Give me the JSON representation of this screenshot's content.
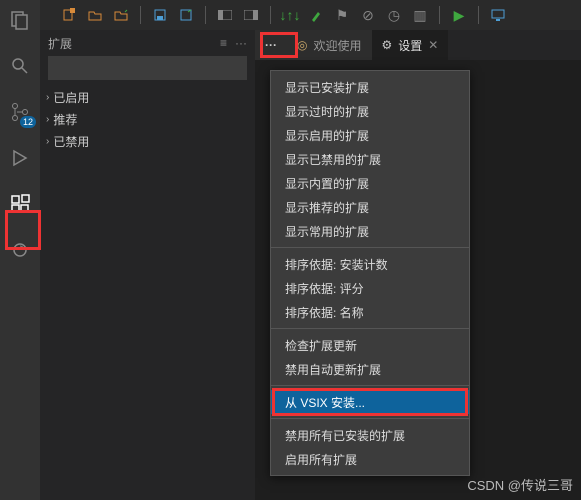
{
  "toolbar": {
    "icons": [
      "new-file",
      "open-folder",
      "folder-up",
      "save",
      "save-arrow",
      "window-left",
      "window-right",
      "tune",
      "brush",
      "arrow",
      "ban",
      "timer",
      "split",
      "play",
      "monitor"
    ]
  },
  "activity": {
    "badge": "12"
  },
  "sidePanel": {
    "title": "扩展",
    "sections": [
      {
        "label": "已启用"
      },
      {
        "label": "推荐"
      },
      {
        "label": "已禁用"
      }
    ]
  },
  "tabs": {
    "more": "···",
    "welcome": "欢迎使用",
    "settings": "设置"
  },
  "menu": {
    "g1": [
      "显示已安装扩展",
      "显示过时的扩展",
      "显示启用的扩展",
      "显示已禁用的扩展",
      "显示内置的扩展",
      "显示推荐的扩展",
      "显示常用的扩展"
    ],
    "g2": [
      "排序依据: 安装计数",
      "排序依据: 评分",
      "排序依据: 名称"
    ],
    "g3": [
      "检查扩展更新",
      "禁用自动更新扩展"
    ],
    "g4": [
      "从 VSIX 安装..."
    ],
    "g5": [
      "禁用所有已安装的扩展",
      "启用所有扩展"
    ]
  },
  "watermark": "CSDN @传说三哥"
}
